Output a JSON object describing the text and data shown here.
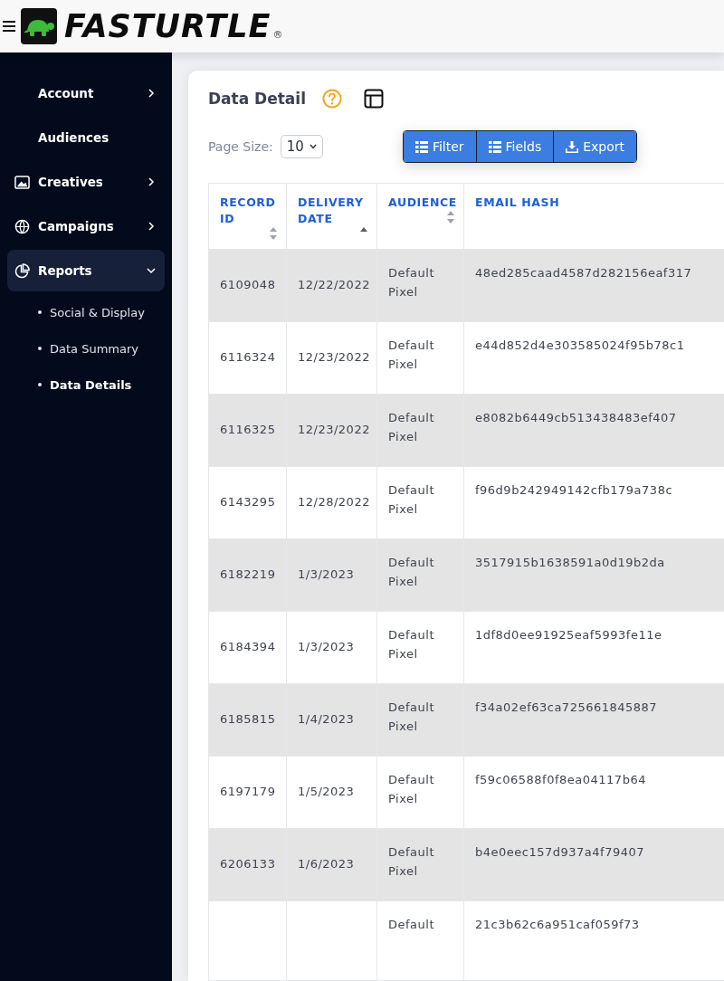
{
  "header": {
    "logo": {
      "wordmark": "FASTURTLE",
      "registered": "®"
    }
  },
  "sidebar": {
    "items": [
      {
        "label": "Account",
        "kind": "group",
        "expanded": false,
        "selected": false
      },
      {
        "label": "Audiences",
        "kind": "link",
        "selected": false
      },
      {
        "label": "Creatives",
        "kind": "group",
        "expanded": false,
        "selected": false
      },
      {
        "label": "Campaigns",
        "kind": "group",
        "expanded": false,
        "selected": false
      },
      {
        "label": "Reports",
        "kind": "group",
        "expanded": true,
        "selected": true,
        "children": [
          {
            "label": "Social & Display",
            "selected": false
          },
          {
            "label": "Data Summary",
            "selected": false
          },
          {
            "label": "Data Details",
            "selected": true
          }
        ]
      }
    ]
  },
  "card": {
    "title": "Data Detail",
    "page_size": {
      "label": "Page Size:",
      "value": "10"
    },
    "buttons": [
      {
        "label": "Filter",
        "kind": "list"
      },
      {
        "label": "Fields",
        "kind": "list"
      },
      {
        "label": "Export",
        "kind": "download"
      }
    ]
  },
  "table": {
    "columns": [
      {
        "label": "RECORD ID",
        "sorted": false
      },
      {
        "label": "DELIVERY DATE",
        "sorted": true
      },
      {
        "label": "AUDIENCE",
        "sorted": false
      },
      {
        "label": "EMAIL HASH"
      }
    ],
    "rows": [
      {
        "record_id": "6109048",
        "delivery_date": "12/22/2022",
        "audience": "Default Pixel",
        "email_hash": "48ed285caad4587d282156eaf317"
      },
      {
        "record_id": "6116324",
        "delivery_date": "12/23/2022",
        "audience": "Default Pixel",
        "email_hash": "e44d852d4e303585024f95b78c1"
      },
      {
        "record_id": "6116325",
        "delivery_date": "12/23/2022",
        "audience": "Default Pixel",
        "email_hash": "e8082b6449cb513438483ef407"
      },
      {
        "record_id": "6143295",
        "delivery_date": "12/28/2022",
        "audience": "Default Pixel",
        "email_hash": "f96d9b242949142cfb179a738c"
      },
      {
        "record_id": "6182219",
        "delivery_date": "1/3/2023",
        "audience": "Default Pixel",
        "email_hash": "3517915b1638591a0d19b2da"
      },
      {
        "record_id": "6184394",
        "delivery_date": "1/3/2023",
        "audience": "Default Pixel",
        "email_hash": "1df8d0ee91925eaf5993fe11e"
      },
      {
        "record_id": "6185815",
        "delivery_date": "1/4/2023",
        "audience": "Default Pixel",
        "email_hash": "f34a02ef63ca725661845887"
      },
      {
        "record_id": "6197179",
        "delivery_date": "1/5/2023",
        "audience": "Default Pixel",
        "email_hash": "f59c06588f0f8ea04117b64"
      },
      {
        "record_id": "6206133",
        "delivery_date": "1/6/2023",
        "audience": "Default Pixel",
        "email_hash": "b4e0eec157d937a4f79407"
      },
      {
        "audience": "Default",
        "email_hash": "21c3b62c6a951caf059f73"
      }
    ]
  }
}
